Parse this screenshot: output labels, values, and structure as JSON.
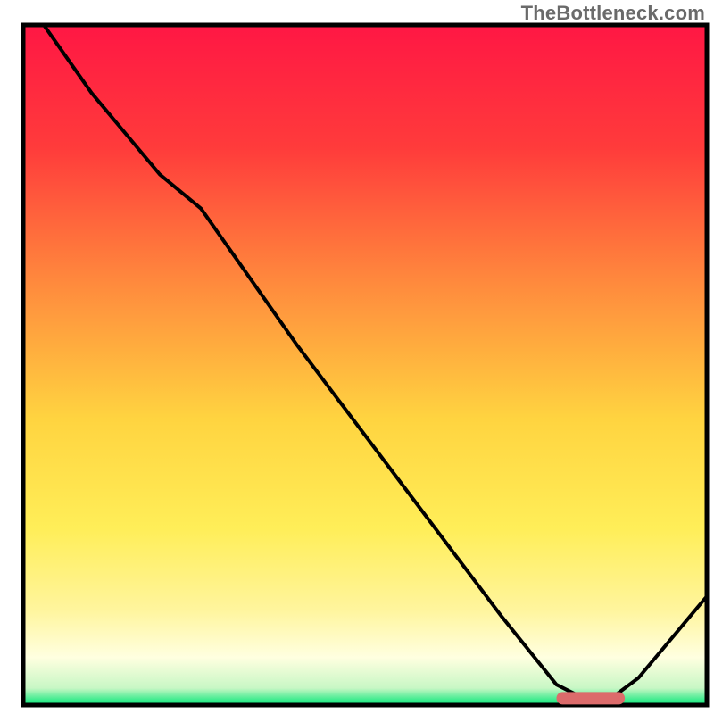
{
  "watermark": "TheBottleneck.com",
  "chart_data": {
    "type": "line",
    "title": "",
    "xlabel": "",
    "ylabel": "",
    "xlim": [
      0,
      100
    ],
    "ylim": [
      0,
      100
    ],
    "x": [
      3,
      10,
      20,
      26,
      40,
      55,
      70,
      78,
      82,
      86,
      90,
      100
    ],
    "values": [
      100,
      90,
      78,
      73,
      53,
      33,
      13,
      3,
      1,
      1,
      4,
      16
    ],
    "optimal_band": {
      "x_start": 78,
      "x_end": 88,
      "y": 1
    },
    "gradient_stops": [
      {
        "offset": 0.0,
        "color": "#ff1744"
      },
      {
        "offset": 0.18,
        "color": "#ff3b3b"
      },
      {
        "offset": 0.38,
        "color": "#ff8a3d"
      },
      {
        "offset": 0.58,
        "color": "#ffd440"
      },
      {
        "offset": 0.74,
        "color": "#ffee58"
      },
      {
        "offset": 0.86,
        "color": "#fff59d"
      },
      {
        "offset": 0.93,
        "color": "#ffffe0"
      },
      {
        "offset": 0.975,
        "color": "#c8f7c5"
      },
      {
        "offset": 1.0,
        "color": "#00e676"
      }
    ]
  }
}
